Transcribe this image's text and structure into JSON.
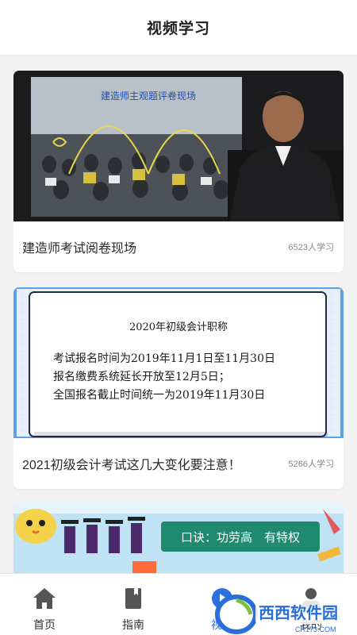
{
  "header": {
    "title": "视频学习"
  },
  "videos": [
    {
      "thumb_caption": "建造师主观题评卷现场",
      "title": "建造师考试阅卷现场",
      "count": "6523人学习"
    },
    {
      "notice": {
        "heading": "2020年初级会计职称",
        "lines": [
          "考试报名时间为2019年11月1日至11月30日",
          "报名缴费系统延长开放至12月5日；",
          "全国报名截止时间统一为2019年11月30日"
        ]
      },
      "title": "2021初级会计考试这几大变化要注意！",
      "count": "5266人学习"
    },
    {
      "banner_text": "口诀：功劳高　有特权"
    }
  ],
  "tabbar": {
    "tabs": [
      {
        "label": "首页",
        "icon": "home-icon"
      },
      {
        "label": "指南",
        "icon": "book-icon"
      },
      {
        "label": "视频",
        "icon": "play-icon"
      },
      {
        "label": "我的",
        "icon": "person-icon"
      }
    ]
  },
  "watermark": {
    "brand": "西西软件园",
    "url": "CR173.COM"
  },
  "colors": {
    "accent": "#2d6fe0",
    "notice_border": "#5aa3e8",
    "banner_green": "#1f8a6e"
  }
}
